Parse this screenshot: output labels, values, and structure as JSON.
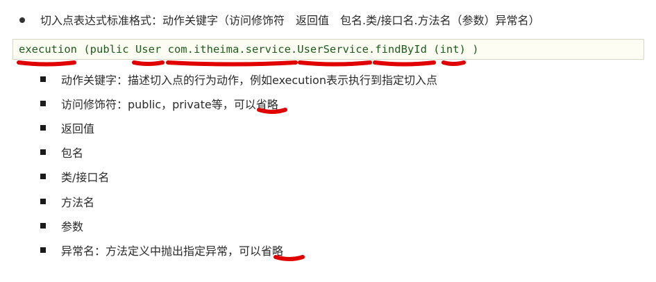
{
  "heading": {
    "text": "切入点表达式标准格式：动作关键字（访问修饰符　返回值　包名.类/接口名.方法名（参数）异常名）"
  },
  "code": {
    "line": "execution (public User com.itheima.service.UserService.findById (int) )"
  },
  "items": [
    {
      "text": "动作关键字：描述切入点的行为动作，例如execution表示执行到指定切入点"
    },
    {
      "text": "访问修饰符：public，private等，可以省略"
    },
    {
      "text": "返回值"
    },
    {
      "text": "包名"
    },
    {
      "text": "类/接口名"
    },
    {
      "text": "方法名"
    },
    {
      "text": "参数"
    },
    {
      "text": "异常名：方法定义中抛出指定异常，可以省略"
    }
  ],
  "colors": {
    "annotation": "#e00000",
    "code_text": "#1c5c1c",
    "code_background": "#fdfdf4"
  },
  "icons": {
    "heading_bullet": "round-bullet-icon",
    "item_bullet": "square-bullet-icon"
  }
}
